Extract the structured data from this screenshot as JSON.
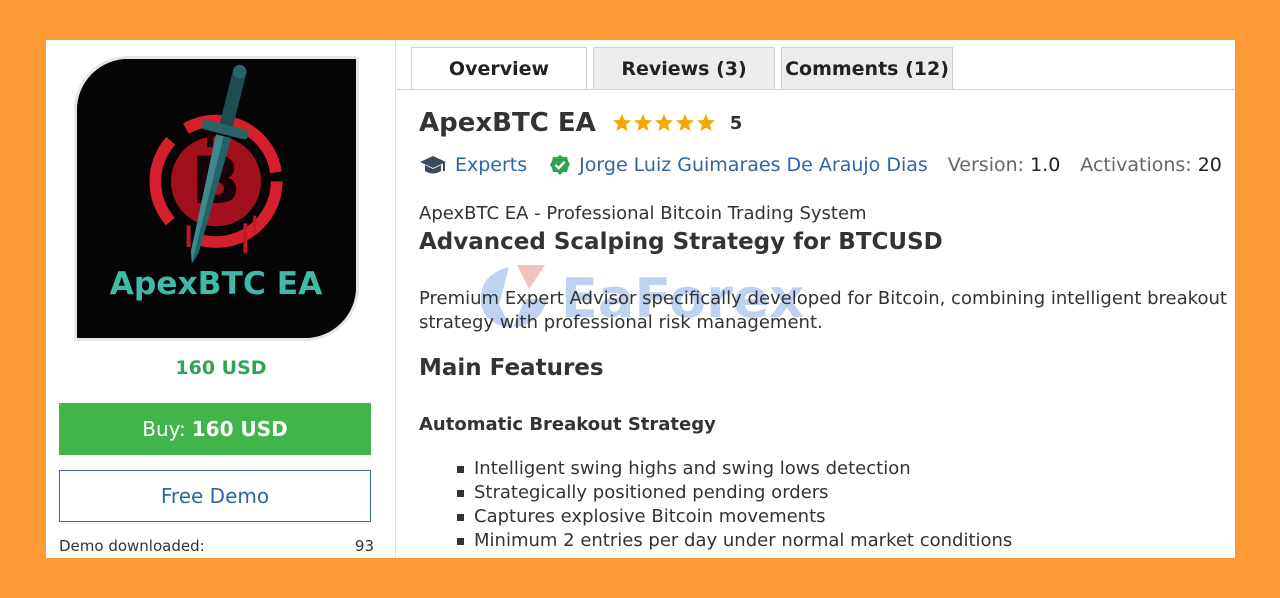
{
  "product": {
    "image_alt": "ApexBTC EA",
    "image_text": "ApexBTC EA",
    "price": "160 USD",
    "buy_label": "Buy:",
    "buy_price": "160 USD",
    "demo_label": "Free Demo",
    "demo_downloaded_label": "Demo downloaded:",
    "demo_downloaded_count": "93"
  },
  "tabs": [
    {
      "label": "Overview"
    },
    {
      "label": "Reviews (3)"
    },
    {
      "label": "Comments (12)"
    }
  ],
  "header": {
    "title": "ApexBTC EA",
    "rating": "5",
    "stars_filled": 5,
    "star_color": "#f2a900"
  },
  "meta": {
    "category": "Experts",
    "author": "Jorge Luiz Guimaraes De Araujo Dias",
    "version_label": "Version:",
    "version_value": "1.0",
    "activations_label": "Activations:",
    "activations_value": "20"
  },
  "content": {
    "subtitle": "ApexBTC EA - Professional Bitcoin Trading System",
    "headline": "Advanced Scalping Strategy for BTCUSD",
    "description": "Premium Expert Advisor specifically developed for Bitcoin, combining intelligent breakout strategy with professional risk management.",
    "features_title": "Main Features",
    "strategy_title": "Automatic Breakout Strategy",
    "features": [
      "Intelligent swing highs and swing lows detection",
      "Strategically positioned pending orders",
      "Captures explosive Bitcoin movements",
      "Minimum 2 entries per day under normal market conditions"
    ]
  },
  "watermark": {
    "text": "EaForex"
  },
  "colors": {
    "background": "#fd9a35",
    "buy": "#41b549",
    "price": "#2ea44f",
    "link": "#2f65a6"
  }
}
